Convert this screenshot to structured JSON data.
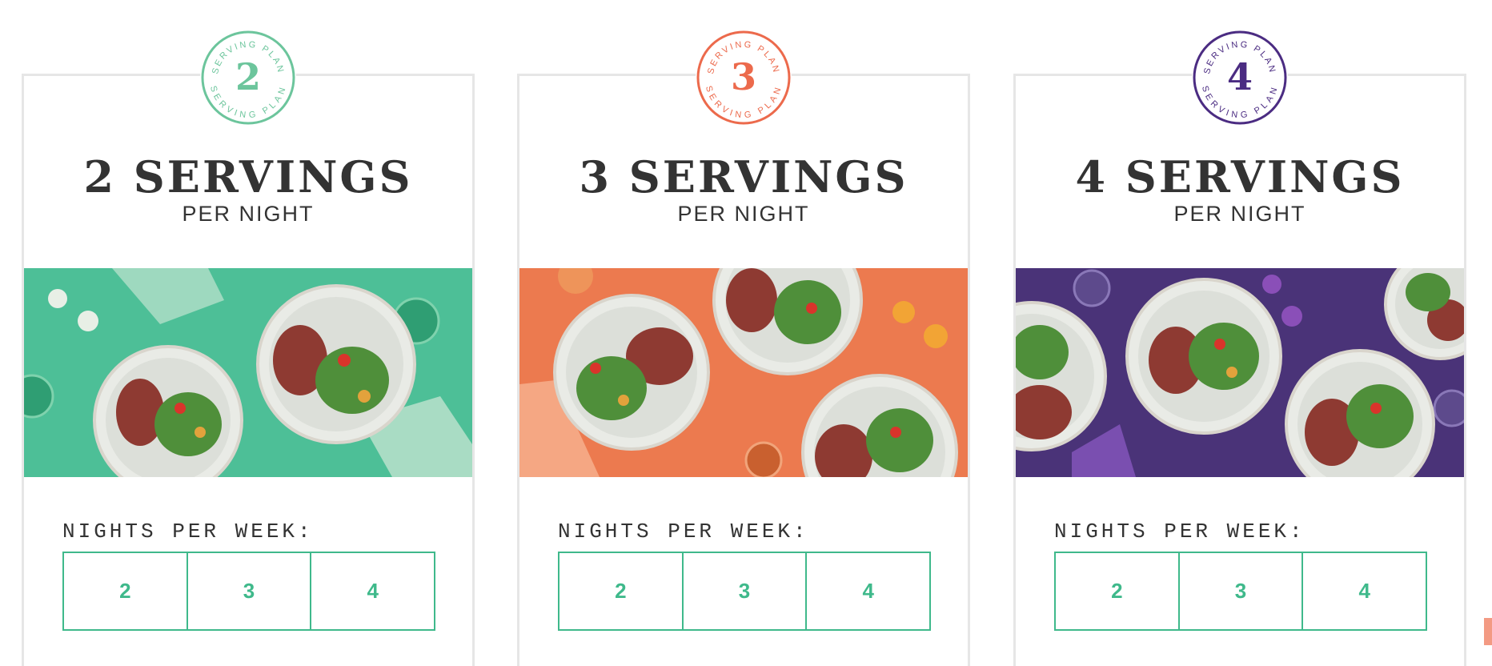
{
  "plans": [
    {
      "badge": {
        "ring_text": "SERVING PLAN",
        "number": "2",
        "color": "#6cc59c"
      },
      "title": "2 SERVINGS",
      "subtitle": "PER NIGHT",
      "photo": {
        "background": "#4dbf97",
        "plates": 2
      },
      "nights_label": "NIGHTS PER WEEK:",
      "nights_options": [
        "2",
        "3",
        "4"
      ]
    },
    {
      "badge": {
        "ring_text": "SERVING PLAN",
        "number": "3",
        "color": "#ec6a4c"
      },
      "title": "3 SERVINGS",
      "subtitle": "PER NIGHT",
      "photo": {
        "background": "#ec7a4f",
        "plates": 3
      },
      "nights_label": "NIGHTS PER WEEK:",
      "nights_options": [
        "2",
        "3",
        "4"
      ]
    },
    {
      "badge": {
        "ring_text": "SERVING PLAN",
        "number": "4",
        "color": "#4b2c82"
      },
      "title": "4 SERVINGS",
      "subtitle": "PER NIGHT",
      "photo": {
        "background": "#4a3378",
        "plates": 4
      },
      "nights_label": "NIGHTS PER WEEK:",
      "nights_options": [
        "2",
        "3",
        "4"
      ]
    }
  ],
  "colors": {
    "option_accent": "#3fb98b",
    "card_border": "#e6e6e6",
    "heading_text": "#333333"
  }
}
